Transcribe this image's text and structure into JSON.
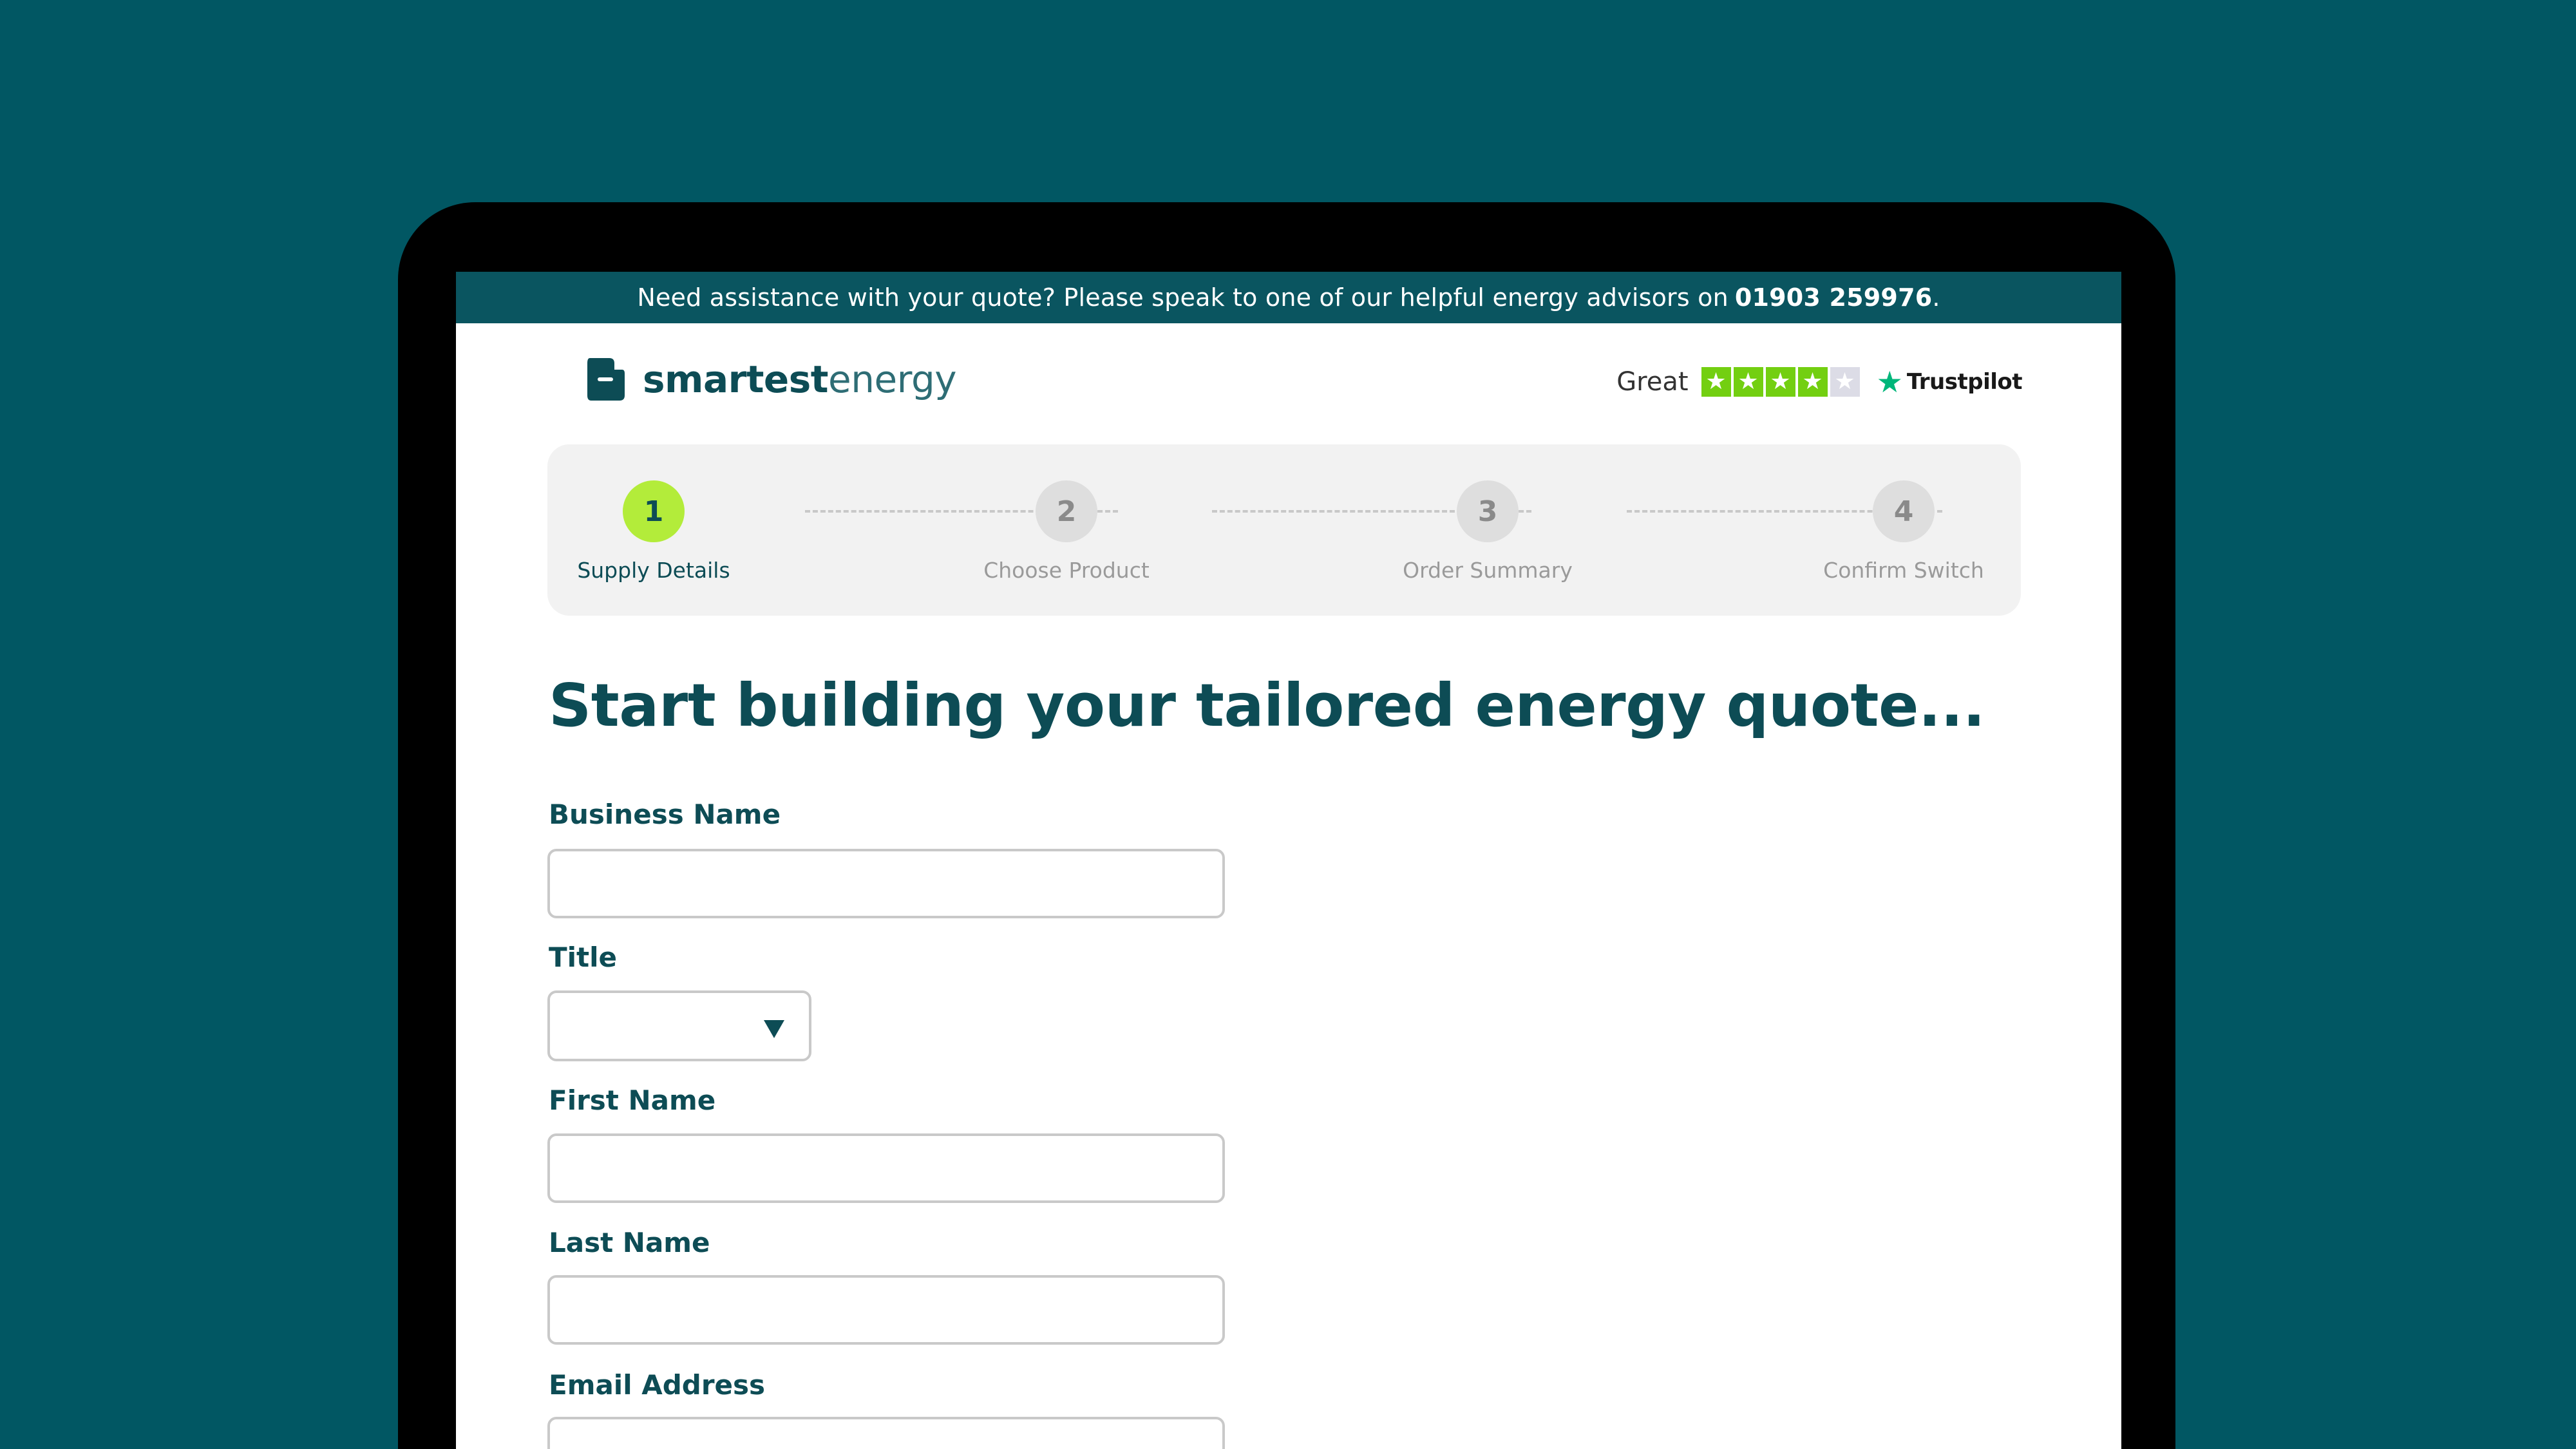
{
  "banner": {
    "text": "Need assistance with your quote? Please speak to one of our helpful energy advisors on",
    "phone": "01903 259976",
    "end": "."
  },
  "brand": {
    "name_bold": "smartest",
    "name_light": "energy",
    "logo_icon": "smartestenergy-logo-icon",
    "color": "#0d4c55"
  },
  "rating": {
    "word": "Great",
    "stars_filled": 4,
    "stars_total": 5,
    "provider": "Trustpilot",
    "star_color": "#73cf11",
    "provider_icon": "trustpilot-star-icon"
  },
  "stepper": {
    "steps": [
      {
        "number": "1",
        "label": "Supply Details",
        "active": true
      },
      {
        "number": "2",
        "label": "Choose Product",
        "active": false
      },
      {
        "number": "3",
        "label": "Order Summary",
        "active": false
      },
      {
        "number": "4",
        "label": "Confirm Switch",
        "active": false
      }
    ],
    "active_color": "#b3ec3a"
  },
  "form": {
    "title": "Start building your tailored energy quote...",
    "business_name": {
      "label": "Business Name",
      "value": "",
      "placeholder": ""
    },
    "title_field": {
      "label": "Title",
      "value": "",
      "icon": "chevron-down-icon"
    },
    "first_name": {
      "label": "First Name",
      "value": "",
      "placeholder": ""
    },
    "last_name": {
      "label": "Last Name",
      "value": "",
      "placeholder": ""
    },
    "email": {
      "label": "Email Address",
      "value": "",
      "placeholder": ""
    }
  },
  "colors": {
    "background": "#015763",
    "banner": "#0a5560",
    "heading": "#0d4c55"
  }
}
